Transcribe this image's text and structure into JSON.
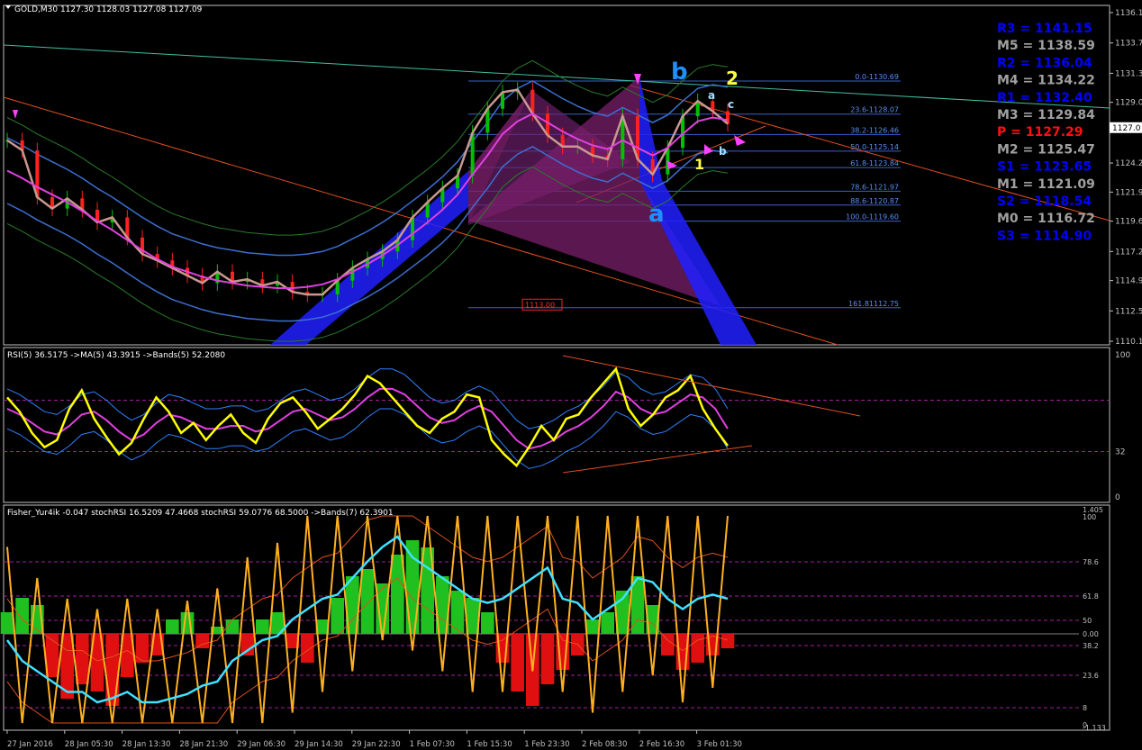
{
  "chart_data": [
    {
      "type": "line",
      "title": "GOLD,M30",
      "ohlc": "1127.30 1128.03 1127.08 1127.09",
      "ylim": [
        1110.1,
        1136.1
      ],
      "y_ticks": [
        {
          "v": 1136.1,
          "label": "1136.1"
        },
        {
          "v": 1133.7,
          "label": "1133.7"
        },
        {
          "v": 1131.3,
          "label": "1131.3"
        },
        {
          "v": 1129.0,
          "label": "1129.0"
        },
        {
          "v": 1124.2,
          "label": "1124.2"
        },
        {
          "v": 1121.9,
          "label": "1121.9"
        },
        {
          "v": 1119.6,
          "label": "1119.6"
        },
        {
          "v": 1117.2,
          "label": "1117.2"
        },
        {
          "v": 1114.9,
          "label": "1114.9"
        },
        {
          "v": 1112.5,
          "label": "1112.5"
        },
        {
          "v": 1110.1,
          "label": "1110.1"
        }
      ],
      "current_price": "1127.0",
      "x_labels": [
        "27 Jan 2016",
        "28 Jan 05:30",
        "28 Jan 13:30",
        "28 Jan 21:30",
        "29 Jan 06:30",
        "29 Jan 14:30",
        "29 Jan 22:30",
        "1 Feb 07:30",
        "1 Feb 15:30",
        "1 Feb 23:30",
        "2 Feb 08:30",
        "2 Feb 16:30",
        "3 Feb 01:30"
      ],
      "series": [
        {
          "name": "",
          "color": "#c89890",
          "values": [
            1126.0,
            1125.2,
            1121.5,
            1120.6,
            1121.4,
            1120.5,
            1119.5,
            1119.9,
            1118.3,
            1117.0,
            1116.5,
            1115.9,
            1115.3,
            1114.7,
            1115.6,
            1114.8,
            1115.0,
            1114.5,
            1114.8,
            1114.0,
            1113.8,
            1113.8,
            1114.9,
            1115.9,
            1116.6,
            1117.2,
            1118.1,
            1119.9,
            1121.1,
            1122.2,
            1123.2,
            1126.6,
            1128.5,
            1129.8,
            1130.0,
            1128.1,
            1126.4,
            1125.5,
            1125.5,
            1124.8,
            1124.5,
            1127.9,
            1124.5,
            1123.3,
            1125.4,
            1127.9,
            1129.1,
            1128.3,
            1127.3
          ]
        },
        {
          "name": "",
          "color": "#e040e0",
          "values": [
            1123.6,
            1123.0,
            1122.3,
            1121.7,
            1121.1,
            1120.4,
            1119.6,
            1118.9,
            1118.1,
            1117.3,
            1116.6,
            1116.0,
            1115.6,
            1115.2,
            1114.9,
            1114.7,
            1114.5,
            1114.4,
            1114.3,
            1114.3,
            1114.4,
            1114.6,
            1115.0,
            1115.6,
            1116.2,
            1116.9,
            1117.7,
            1118.6,
            1119.5,
            1120.5,
            1121.7,
            1123.3,
            1124.8,
            1126.5,
            1127.5,
            1128.1,
            1127.4,
            1126.7,
            1126.1,
            1125.6,
            1125.3,
            1126.0,
            1125.4,
            1124.8,
            1125.4,
            1126.5,
            1127.5,
            1127.8,
            1127.6
          ]
        }
      ],
      "pivot_levels": [
        {
          "label": "R3 = 1141.15",
          "color": "#0000ff"
        },
        {
          "label": "M5 = 1138.59",
          "color": "#a0a0a0"
        },
        {
          "label": "R2 = 1136.04",
          "color": "#0000ff"
        },
        {
          "label": "M4 = 1134.22",
          "color": "#a0a0a0"
        },
        {
          "label": "R1 = 1132.40",
          "color": "#0000ff"
        },
        {
          "label": "M3 = 1129.84",
          "color": "#a0a0a0"
        },
        {
          "label": "P   = 1127.29",
          "color": "#ff1010"
        },
        {
          "label": "M2 = 1125.47",
          "color": "#a0a0a0"
        },
        {
          "label": "S1 = 1123.65",
          "color": "#0000ff"
        },
        {
          "label": "M1 = 1121.09",
          "color": "#a0a0a0"
        },
        {
          "label": "S2 = 1118.54",
          "color": "#0000ff"
        },
        {
          "label": "M0 = 1116.72",
          "color": "#a0a0a0"
        },
        {
          "label": "S3 = 1114.90",
          "color": "#0000ff"
        }
      ],
      "fib_levels": [
        {
          "label": "0.0-1130.69",
          "price": 1130.69
        },
        {
          "label": "23.6-1128.07",
          "price": 1128.07
        },
        {
          "label": "38.2-1126.46",
          "price": 1126.46
        },
        {
          "label": "50.0-1125.14",
          "price": 1125.14
        },
        {
          "label": "61.8-1123.84",
          "price": 1123.84
        },
        {
          "label": "78.6-1121.97",
          "price": 1121.97
        },
        {
          "label": "88.6-1120.87",
          "price": 1120.87
        },
        {
          "label": "100.0-1119.60",
          "price": 1119.6
        },
        {
          "label": "161.81112.75",
          "price": 1112.75
        }
      ],
      "price_box": {
        "label": "1113.00",
        "price": 1113.0
      },
      "wave_labels": [
        {
          "text": "b",
          "color": "#1e90ff"
        },
        {
          "text": "2",
          "color": "#ffff40"
        },
        {
          "text": "a",
          "color": "#1e90ff"
        },
        {
          "text": "1",
          "color": "#ffff40"
        },
        {
          "text": "a",
          "color": "#a0e0ff"
        },
        {
          "text": "c",
          "color": "#a0e0ff"
        },
        {
          "text": "b",
          "color": "#a0e0ff"
        }
      ]
    },
    {
      "type": "line",
      "title": "RSI(5) 36.5175  ->MA(5) 43.3915  ->Bands(5) 52.2080",
      "ylim": [
        0,
        100
      ],
      "y_ticks": [
        {
          "v": 100,
          "label": "100"
        },
        {
          "v": 32,
          "label": "32"
        },
        {
          "v": 0,
          "label": "0"
        }
      ],
      "series": [
        {
          "name": "RSI(5)",
          "color": "#ffff00",
          "values": [
            70,
            60,
            45,
            35,
            40,
            62,
            75,
            55,
            42,
            30,
            38,
            55,
            70,
            60,
            45,
            52,
            40,
            50,
            58,
            45,
            38,
            55,
            66,
            70,
            60,
            48,
            55,
            62,
            72,
            85,
            80,
            70,
            60,
            50,
            45,
            55,
            60,
            72,
            70,
            40,
            30,
            22,
            35,
            50,
            40,
            55,
            58,
            70,
            80,
            90,
            62,
            50,
            58,
            70,
            75,
            85,
            62,
            48,
            36
          ]
        },
        {
          "name": "MA(5)",
          "color": "#e040e0",
          "values": [
            62,
            58,
            52,
            46,
            44,
            50,
            58,
            60,
            54,
            46,
            40,
            44,
            52,
            58,
            56,
            52,
            48,
            48,
            50,
            50,
            46,
            48,
            54,
            60,
            62,
            58,
            54,
            56,
            62,
            70,
            76,
            76,
            72,
            64,
            56,
            52,
            54,
            60,
            64,
            60,
            50,
            40,
            34,
            36,
            40,
            46,
            50,
            56,
            64,
            74,
            70,
            62,
            58,
            60,
            66,
            72,
            70,
            62,
            48
          ]
        }
      ]
    },
    {
      "type": "bar",
      "title": "Fisher_Yur4ik -0.047  stochRSI 16.5209 47.4668  stochRSI 59.0776 68.5000  ->Bands(7) 62.3901",
      "y_ticks": [
        {
          "v": 1.405,
          "label": "1.405"
        },
        {
          "v": 100,
          "label": "100"
        },
        {
          "v": 78.6,
          "label": "78.6"
        },
        {
          "v": 61.8,
          "label": "61.8"
        },
        {
          "v": 50,
          "label": "50"
        },
        {
          "v": 0.0,
          "label": "0.00"
        },
        {
          "v": 38.2,
          "label": "38.2"
        },
        {
          "v": 23.6,
          "label": "23.6"
        },
        {
          "v": 8,
          "label": "8"
        },
        {
          "v": -1.133,
          "label": "-1.133"
        },
        {
          "v": 0,
          "label": "0"
        }
      ],
      "series": [
        {
          "name": "Fisher_Yur4ik",
          "values": [
            0.3,
            0.5,
            0.4,
            -0.6,
            -0.9,
            -0.7,
            -0.8,
            -1.0,
            -0.6,
            -0.4,
            -0.3,
            0.2,
            0.3,
            -0.2,
            0.1,
            0.2,
            -0.3,
            0.2,
            0.3,
            -0.2,
            -0.4,
            0.2,
            0.5,
            0.8,
            0.9,
            0.7,
            1.1,
            1.3,
            1.2,
            0.8,
            0.6,
            0.5,
            0.3,
            -0.4,
            -0.8,
            -1.0,
            -0.7,
            -0.5,
            -0.3,
            0.2,
            0.3,
            0.6,
            0.8,
            0.4,
            -0.3,
            -0.5,
            -0.4,
            -0.3,
            -0.2
          ]
        },
        {
          "name": "stochRSI",
          "color": "#40e0ff",
          "values": [
            40,
            30,
            25,
            20,
            15,
            15,
            10,
            12,
            15,
            10,
            10,
            12,
            14,
            18,
            20,
            30,
            35,
            40,
            42,
            50,
            55,
            60,
            62,
            70,
            78,
            85,
            90,
            80,
            75,
            70,
            65,
            60,
            58,
            60,
            65,
            70,
            75,
            60,
            58,
            50,
            55,
            60,
            70,
            68,
            60,
            55,
            60,
            62,
            60
          ]
        }
      ]
    }
  ]
}
